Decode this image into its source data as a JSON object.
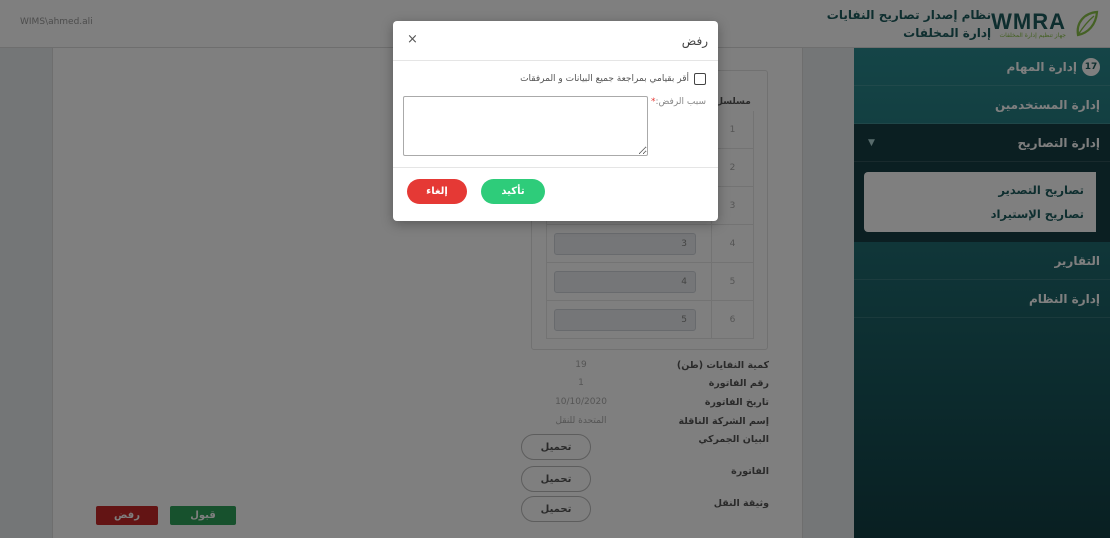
{
  "header": {
    "user_path": "WIMS\\ahmed.ali",
    "system_title": "نظام إصدار تصاريح النفايات",
    "department": "إدارة المخلفات",
    "logo_text": "WMRA",
    "logo_subtitle": "جهاز تنظيم إدارة المخلفات"
  },
  "sidebar": {
    "tasks_label": "إدارة المهام",
    "tasks_badge": "17",
    "users_label": "إدارة المستخدمين",
    "permits_label": "إدارة التصاريح",
    "permits_sub": [
      "تصاريح التصدير",
      "تصاريح الإستيراد"
    ],
    "reports_label": "التقارير",
    "system_label": "إدارة النظام"
  },
  "table": {
    "header": "مسلسل",
    "rows": [
      {
        "num": "1",
        "value": ""
      },
      {
        "num": "2",
        "value": ""
      },
      {
        "num": "3",
        "value": ""
      },
      {
        "num": "4",
        "value": "3"
      },
      {
        "num": "5",
        "value": "4"
      },
      {
        "num": "6",
        "value": "5"
      }
    ]
  },
  "details": {
    "quantity_label": "كمية النفايات (طن)",
    "quantity_value": "19",
    "invoice_no_label": "رقم الفاتورة",
    "invoice_no_value": "1",
    "invoice_date_label": "تاريخ الفاتورة",
    "invoice_date_value": "10/10/2020",
    "carrier_label": "إسم الشركة الناقلة",
    "carrier_value": "المتحدة للنقل",
    "customs_label": "البيان الجمركي",
    "invoice_label": "الفاتورة",
    "transport_doc_label": "وثيقة النقل",
    "download_label": "تحميل"
  },
  "actions": {
    "accept_label": "قبول",
    "reject_label": "رفض"
  },
  "modal": {
    "title": "رفض",
    "close_label": "×",
    "confirm_text": "أقر بقيامي بمراجعة جميع البيانات و المرفقات",
    "reason_label": "سبب الرفض:",
    "required_mark": "*",
    "reason_value": "",
    "confirm_button": "تأكيد",
    "cancel_button": "إلغاء"
  },
  "colors": {
    "brand": "#1d5c5e",
    "accept": "#2fa35a",
    "reject": "#c62828",
    "confirm": "#2ecc7a",
    "cancel": "#e53935"
  }
}
